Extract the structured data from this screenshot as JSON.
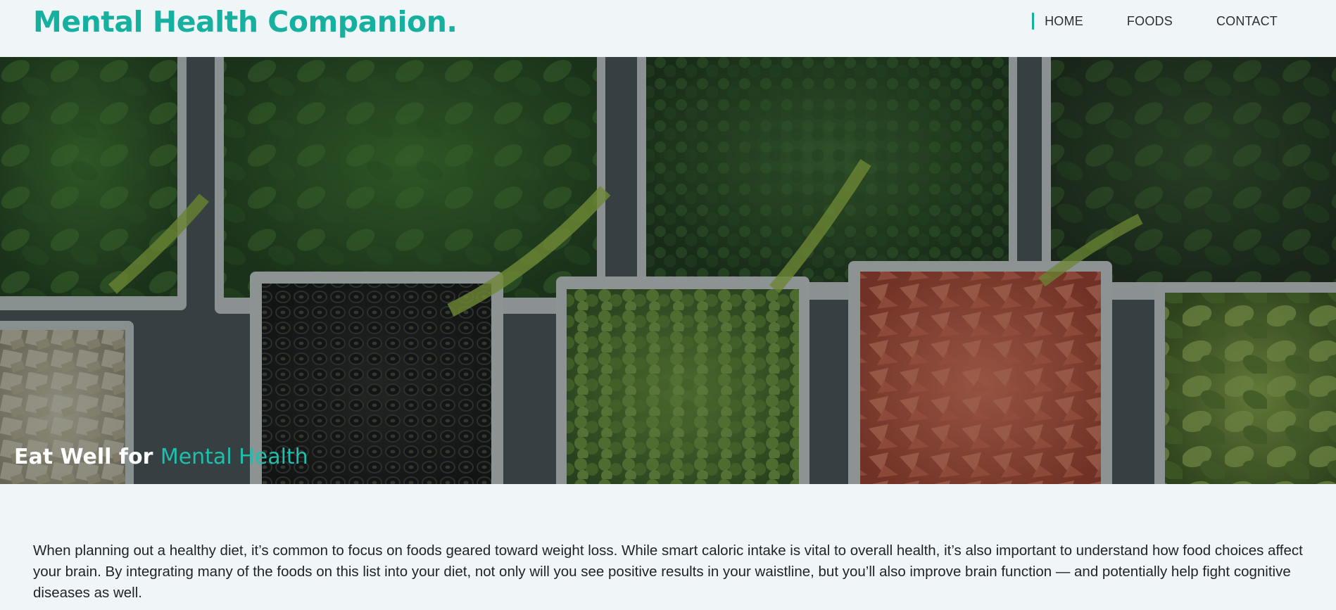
{
  "header": {
    "logo": "Mental Health Companion.",
    "nav": [
      {
        "label": "HOME",
        "active": true
      },
      {
        "label": "FOODS",
        "active": false
      },
      {
        "label": "CONTACT",
        "active": false
      }
    ]
  },
  "hero": {
    "title_strong": "Eat Well for",
    "title_accent": "Mental Health",
    "image": "vegetables-in-white-trays",
    "accent_color": "#1fbfae"
  },
  "intro": {
    "text": "When planning out a healthy diet, it’s common to focus on foods geared toward weight loss. While smart caloric intake is vital to overall health, it’s also important to understand how food choices affect your brain. By integrating many of the foods on this list into your diet, not only will you see positive results in your waistline, but you’ll also improve brain function — and potentially help fight cognitive diseases as well."
  },
  "colors": {
    "brand": "#15b0a0",
    "background": "#f0f5f8",
    "text": "#1f2328"
  }
}
